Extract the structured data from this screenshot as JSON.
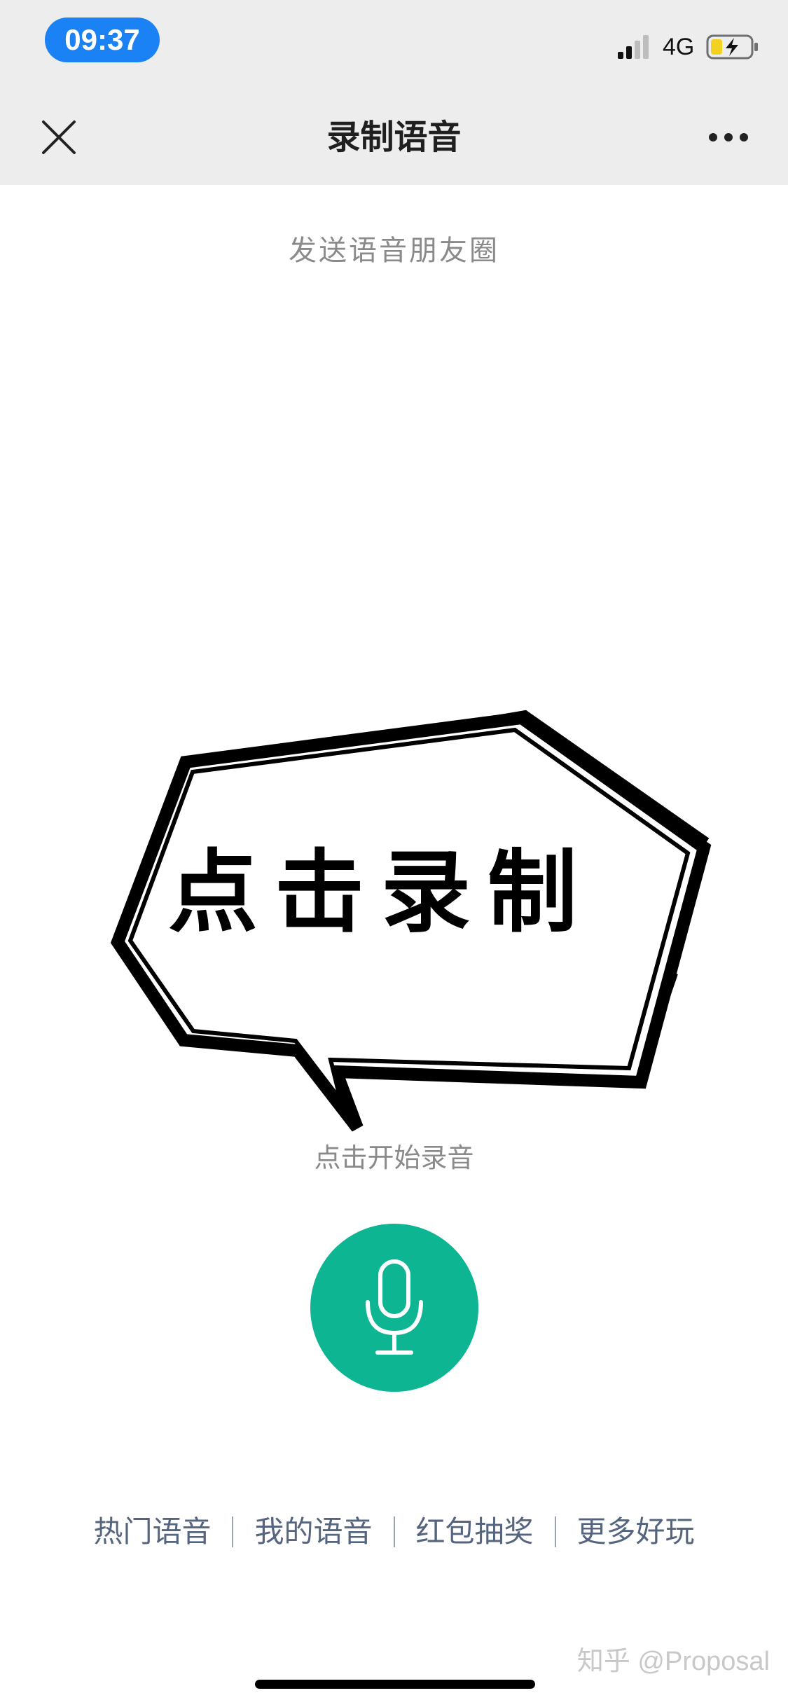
{
  "status_bar": {
    "time": "09:37",
    "network": "4G"
  },
  "header": {
    "title": "录制语音"
  },
  "main": {
    "subtitle": "发送语音朋友圈",
    "bubble_text": "点击录制",
    "hint": "点击开始录音"
  },
  "bottom_nav": {
    "items": [
      "热门语音",
      "我的语音",
      "红包抽奖",
      "更多好玩"
    ]
  },
  "watermark": "知乎 @Proposal",
  "colors": {
    "header_bg": "#ededed",
    "time_pill": "#1a82f5",
    "mic_button": "#0db592",
    "link_text": "#55657f"
  }
}
